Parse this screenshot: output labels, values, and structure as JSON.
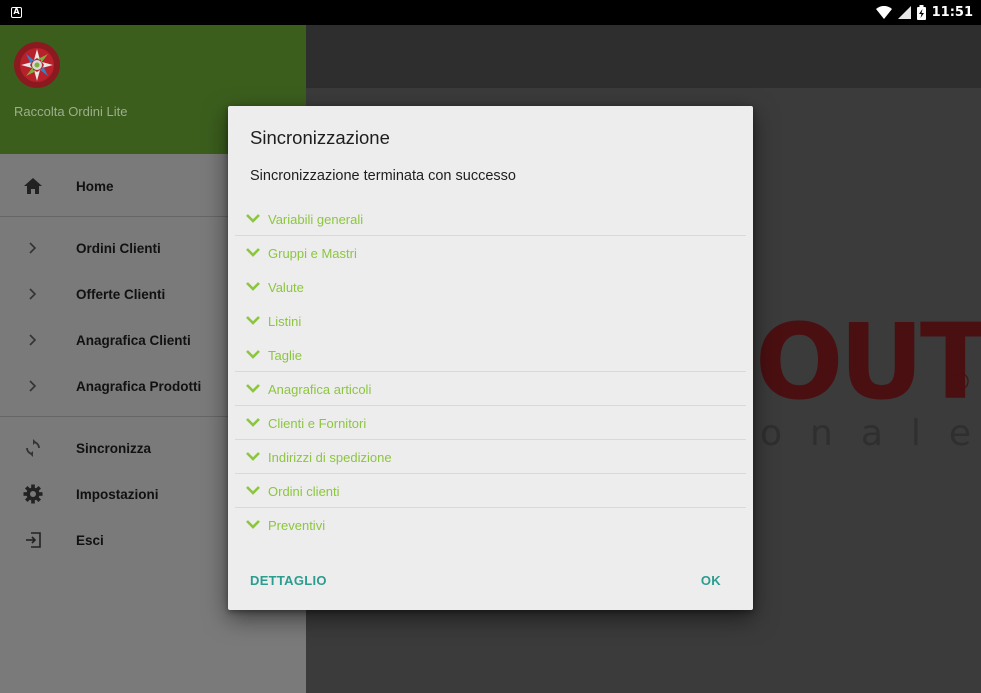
{
  "status_bar": {
    "notification_icon": "android-notification-icon",
    "time": "11:51",
    "icons": [
      "wifi-icon",
      "signal-icon",
      "battery-charging-icon"
    ]
  },
  "drawer": {
    "app_name": "Raccolta Ordini Lite",
    "logo": "app-logo",
    "items": [
      {
        "label": "Home",
        "icon": "home-icon"
      },
      {
        "label": "Ordini Clienti",
        "icon": "chevron-right-icon"
      },
      {
        "label": "Offerte Clienti",
        "icon": "chevron-right-icon"
      },
      {
        "label": "Anagrafica Clienti",
        "icon": "chevron-right-icon"
      },
      {
        "label": "Anagrafica Prodotti",
        "icon": "chevron-right-icon"
      },
      {
        "label": "Sincronizza",
        "icon": "sync-icon"
      },
      {
        "label": "Impostazioni",
        "icon": "gear-icon"
      },
      {
        "label": "Esci",
        "icon": "exit-icon"
      }
    ]
  },
  "background": {
    "brand_main": "OUT",
    "brand_reg": "®",
    "brand_sub": "onale"
  },
  "dialog": {
    "title": "Sincronizzazione",
    "message": "Sincronizzazione terminata con successo",
    "items": [
      "Variabili generali",
      "Gruppi e Mastri",
      "Valute",
      "Listini",
      "Taglie",
      "Anagrafica articoli",
      "Clienti e Fornitori",
      "Indirizzi di spedizione",
      "Ordini clienti",
      "Preventivi"
    ],
    "buttons": {
      "detail": "DETTAGLIO",
      "ok": "OK"
    }
  },
  "colors": {
    "drawer_header": "#3b5e1d",
    "accent_green": "#8cc63e",
    "button_teal": "#2a9d8f"
  }
}
